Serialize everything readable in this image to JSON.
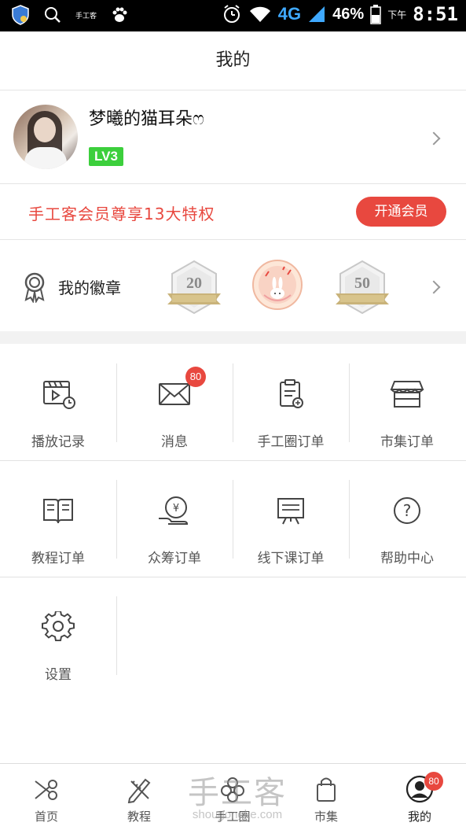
{
  "status_bar": {
    "small_app_label": "手工客",
    "baidu_label": "du",
    "network": "4G",
    "battery": "46%",
    "time_period": "下午",
    "time": "8:51"
  },
  "header": {
    "title": "我的"
  },
  "profile": {
    "username": "梦曦的猫耳朵ෆ",
    "level": "LV3"
  },
  "vip": {
    "text": "手工客会员尊享13大特权",
    "button": "开通会员"
  },
  "badges": {
    "title": "我的徽章",
    "items": [
      {
        "label": "20",
        "icon": "badge-20-icon"
      },
      {
        "label": "",
        "icon": "badge-bunny-icon"
      },
      {
        "label": "50",
        "icon": "badge-50-icon"
      }
    ]
  },
  "grid": {
    "items": [
      {
        "label": "播放记录",
        "icon": "video-history-icon"
      },
      {
        "label": "消息",
        "icon": "envelope-icon",
        "badge": "80"
      },
      {
        "label": "手工圈订单",
        "icon": "clipboard-icon"
      },
      {
        "label": "市集订单",
        "icon": "shop-icon"
      },
      {
        "label": "教程订单",
        "icon": "book-icon"
      },
      {
        "label": "众筹订单",
        "icon": "crowdfund-icon"
      },
      {
        "label": "线下课订单",
        "icon": "board-icon"
      },
      {
        "label": "帮助中心",
        "icon": "help-icon"
      },
      {
        "label": "设置",
        "icon": "gear-icon"
      }
    ]
  },
  "bottom_nav": {
    "items": [
      {
        "label": "首页",
        "icon": "scissors-icon"
      },
      {
        "label": "教程",
        "icon": "pencil-ruler-icon"
      },
      {
        "label": "手工圈",
        "icon": "flower-icon"
      },
      {
        "label": "市集",
        "icon": "bag-icon"
      },
      {
        "label": "我的",
        "icon": "user-icon",
        "badge": "80",
        "active": true
      }
    ]
  },
  "watermark": {
    "title": "手工客",
    "url": "shougongke.com"
  },
  "colors": {
    "accent": "#e8483f",
    "level": "#3ccf3c"
  }
}
